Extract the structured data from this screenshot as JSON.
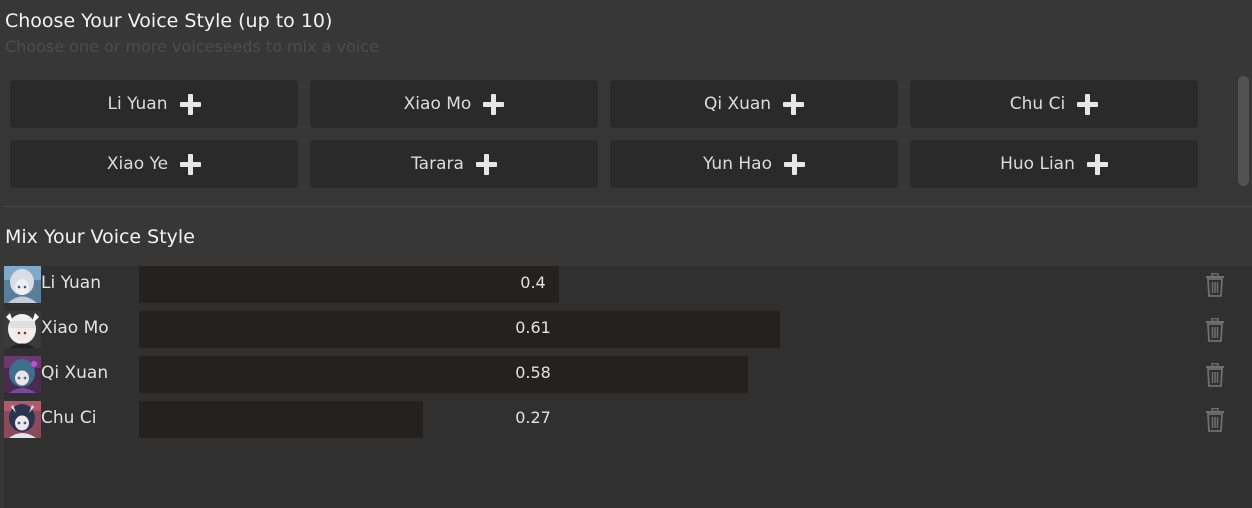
{
  "header": {
    "title": "Choose Your Voice Style (up to 10)",
    "subtitle": "Choose one or more voiceseeds to mix a voice"
  },
  "voice_seeds": [
    {
      "label": "Li Yuan"
    },
    {
      "label": "Xiao Mo"
    },
    {
      "label": "Qi Xuan"
    },
    {
      "label": "Chu Ci"
    },
    {
      "label": "Xiao Ye"
    },
    {
      "label": "Tarara"
    },
    {
      "label": "Yun Hao"
    },
    {
      "label": "Huo Lian"
    }
  ],
  "mix": {
    "title": "Mix Your Voice Style",
    "rows": [
      {
        "name": "Li Yuan",
        "value": "0.4",
        "weight": 0.4,
        "avatar": "avatar-li-yuan"
      },
      {
        "name": "Xiao Mo",
        "value": "0.61",
        "weight": 0.61,
        "avatar": "avatar-xiao-mo"
      },
      {
        "name": "Qi Xuan",
        "value": "0.58",
        "weight": 0.58,
        "avatar": "avatar-qi-xuan"
      },
      {
        "name": "Chu Ci",
        "value": "0.27",
        "weight": 0.27,
        "avatar": "avatar-chu-ci"
      }
    ]
  },
  "colors": {
    "background": "#373737",
    "button": "#2a2a2a",
    "slider_fill": "#242121",
    "panel": "#303030"
  }
}
